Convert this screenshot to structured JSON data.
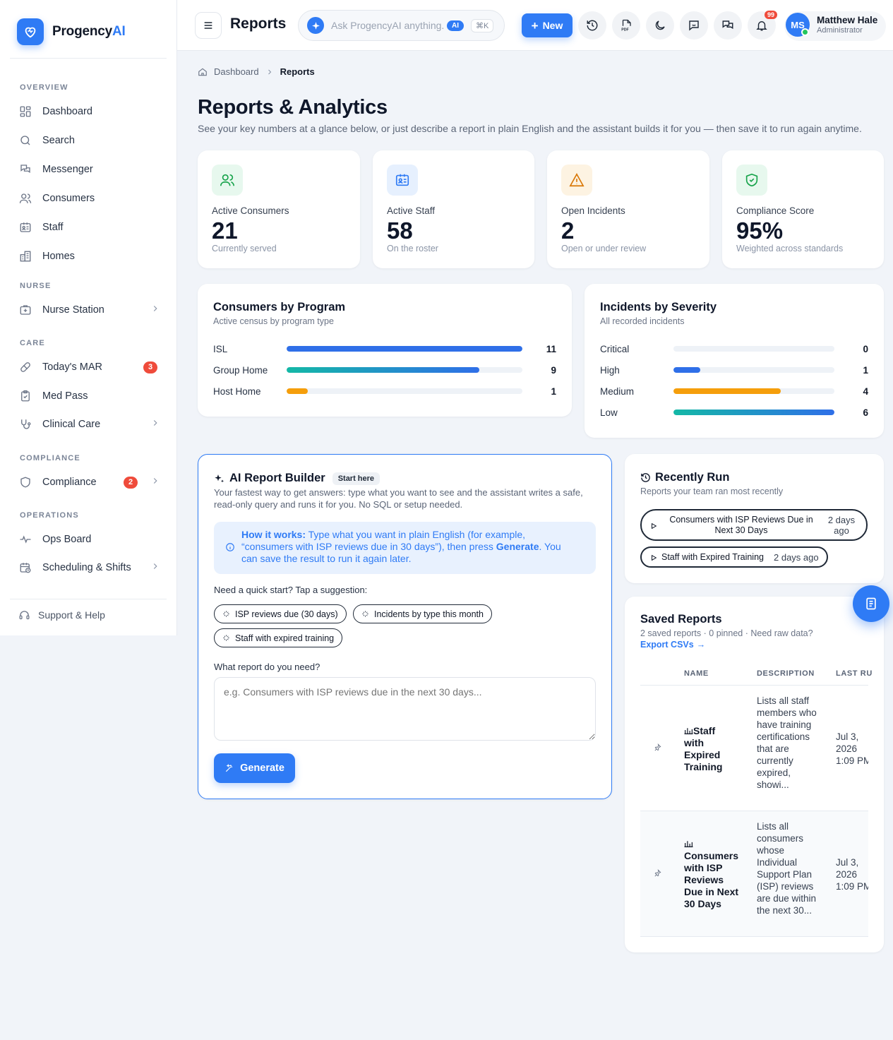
{
  "brand": {
    "name_main": "Progency",
    "name_accent": "AI"
  },
  "sidebar": {
    "sections": {
      "overview": "OVERVIEW",
      "nurse": "NURSE",
      "care": "CARE",
      "compliance": "COMPLIANCE",
      "operations": "OPERATIONS"
    },
    "items": {
      "dashboard": "Dashboard",
      "search": "Search",
      "messenger": "Messenger",
      "consumers": "Consumers",
      "staff": "Staff",
      "homes": "Homes",
      "nurse_station": "Nurse Station",
      "todays_mar": "Today's MAR",
      "todays_mar_badge": "3",
      "med_pass": "Med Pass",
      "clinical_care": "Clinical Care",
      "compliance": "Compliance",
      "compliance_badge": "2",
      "ops_board": "Ops Board",
      "scheduling": "Scheduling & Shifts"
    },
    "support": "Support & Help"
  },
  "topbar": {
    "title": "Reports",
    "ask_placeholder": "Ask ProgencyAI anything...",
    "ai_pill": "AI",
    "shortcut": "⌘K",
    "new_label": "New",
    "notif_count": "99",
    "user": {
      "initials": "MS",
      "name": "Matthew Hale",
      "role": "Administrator"
    }
  },
  "breadcrumb": {
    "home": "Dashboard",
    "current": "Reports"
  },
  "page": {
    "title": "Reports & Analytics",
    "subtitle": "See your key numbers at a glance below, or just describe a report in plain English and the assistant builds it for you — then save it to run again anytime."
  },
  "kpis": [
    {
      "label": "Active Consumers",
      "value": "21",
      "note": "Currently served",
      "color": "#16a34a",
      "bg": "#e7f8ee"
    },
    {
      "label": "Active Staff",
      "value": "58",
      "note": "On the roster",
      "color": "#2f7bf5",
      "bg": "#e6f0fe"
    },
    {
      "label": "Open Incidents",
      "value": "2",
      "note": "Open or under review",
      "color": "#d97706",
      "bg": "#fdf3e2"
    },
    {
      "label": "Compliance Score",
      "value": "95%",
      "note": "Weighted across standards",
      "color": "#16a34a",
      "bg": "#e7f8ee"
    }
  ],
  "programs": {
    "title": "Consumers by Program",
    "subtitle": "Active census by program type",
    "max": 11,
    "rows": [
      {
        "label": "ISL",
        "value": 11,
        "color": "#2f6fe8"
      },
      {
        "label": "Group Home",
        "value": 9,
        "color": "teal-blue"
      },
      {
        "label": "Host Home",
        "value": 1,
        "color": "#f59e0b"
      }
    ]
  },
  "severity": {
    "title": "Incidents by Severity",
    "subtitle": "All recorded incidents",
    "max": 6,
    "rows": [
      {
        "label": "Critical",
        "value": 0,
        "color": "#ef4444"
      },
      {
        "label": "High",
        "value": 1,
        "color": "#2f6fe8"
      },
      {
        "label": "Medium",
        "value": 4,
        "color": "#f59e0b"
      },
      {
        "label": "Low",
        "value": 6,
        "color": "teal-blue"
      }
    ]
  },
  "builder": {
    "title": "AI Report Builder",
    "tag": "Start here",
    "description": "Your fastest way to get answers: type what you want to see and the assistant writes a safe, read-only query and runs it for you. No SQL or setup needed.",
    "howto_lead": "How it works:",
    "howto_body_1": " Type what you want in plain English (for example, “consumers with ISP reviews due in 30 days”), then press ",
    "howto_generate": "Generate",
    "howto_body_2": ". You can save the result to run it again later.",
    "quick_label": "Need a quick start? Tap a suggestion:",
    "suggestions": [
      "ISP reviews due (30 days)",
      "Incidents by type this month",
      "Staff with expired training"
    ],
    "question_label": "What report do you need?",
    "textarea_placeholder": "e.g. Consumers with ISP reviews due in the next 30 days...",
    "generate_label": "Generate"
  },
  "recent": {
    "title": "Recently Run",
    "subtitle": "Reports your team ran most recently",
    "items": [
      {
        "name": "Consumers with ISP Reviews Due in Next 30 Days",
        "when": "2 days ago"
      },
      {
        "name": "Staff with Expired Training",
        "when": "2 days ago"
      }
    ]
  },
  "saved": {
    "title": "Saved Reports",
    "summary": "2 saved reports · 0 pinned · Need raw data?",
    "export_label": "Export CSVs",
    "columns": {
      "name": "NAME",
      "description": "DESCRIPTION",
      "last_run": "LAST RU"
    },
    "rows": [
      {
        "name": "Staff with Expired Training",
        "description": "Lists all staff members who have training certifications that are currently expired, showi...",
        "last_run": "Jul 3,\n2026\n1:09 PM"
      },
      {
        "name": "Consumers with ISP Reviews Due in Next 30 Days",
        "description": "Lists all consumers whose Individual Support Plan (ISP) reviews are due within the next 30...",
        "last_run": "Jul 3,\n2026\n1:09 PM"
      }
    ]
  }
}
